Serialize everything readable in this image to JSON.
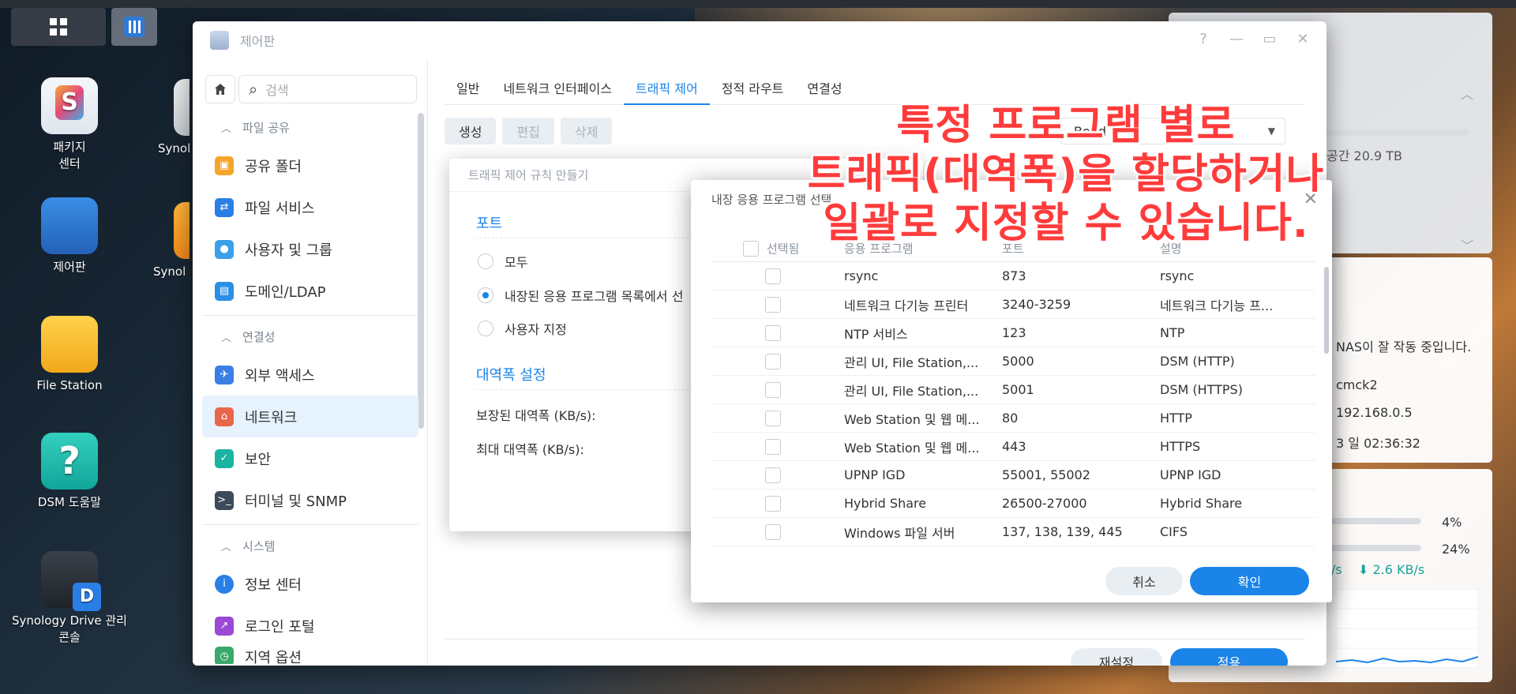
{
  "desktop": {
    "icons": [
      {
        "label": "패키지\n센터"
      },
      {
        "label": "제어판"
      },
      {
        "label": "File Station"
      },
      {
        "label": "DSM 도움말"
      },
      {
        "label": "Synology Drive 관리\n콘솔"
      },
      {
        "label": "Synol"
      },
      {
        "label": "Synol"
      }
    ]
  },
  "window": {
    "title": "제어판",
    "controls": {
      "help": "?",
      "minimize": "—",
      "maximize": "▭",
      "close": "✕"
    }
  },
  "sidebar": {
    "search_placeholder": "검색",
    "groups": [
      {
        "label": "파일 공유",
        "items": [
          "공유 폴더",
          "파일 서비스",
          "사용자 및 그룹",
          "도메인/LDAP"
        ]
      },
      {
        "label": "연결성",
        "items": [
          "외부 액세스",
          "네트워크",
          "보안",
          "터미널 및 SNMP"
        ]
      },
      {
        "label": "시스템",
        "items": [
          "정보 센터",
          "로그인 포털",
          "지역 옵션"
        ]
      }
    ],
    "active_item": "네트워크"
  },
  "tabs": [
    "일반",
    "네트워크 인터페이스",
    "트래픽 제어",
    "정적 라우트",
    "연결성"
  ],
  "active_tab": "트래픽 제어",
  "toolbar": {
    "create": "생성",
    "edit": "편집",
    "delete": "삭제"
  },
  "filter_value": "Bond",
  "footer": {
    "reset": "재설정",
    "apply": "적용"
  },
  "rule_dialog": {
    "title": "트래픽 제어 규칙 만들기",
    "port_section": "포트",
    "options": [
      "모두",
      "내장된 응용 프로그램 목록에서 선",
      "사용자 지정"
    ],
    "selected_option": 1,
    "bandwidth_section": "대역폭 설정",
    "guaranteed_label": "보장된 대역폭 (KB/s):",
    "max_label": "최대 대역폭 (KB/s):"
  },
  "app_dialog": {
    "title": "내장 응용 프로그램 선택",
    "close": "✕",
    "columns": [
      "선택됨",
      "응용 프로그램",
      "포트",
      "설명"
    ],
    "rows": [
      {
        "app": "rsync",
        "port": "873",
        "desc": "rsync"
      },
      {
        "app": "네트워크 다기능 프린터",
        "port": "3240-3259",
        "desc": "네트워크 다기능 프..."
      },
      {
        "app": "NTP 서비스",
        "port": "123",
        "desc": "NTP"
      },
      {
        "app": "관리 UI, File Station,...",
        "port": "5000",
        "desc": "DSM (HTTP)"
      },
      {
        "app": "관리 UI, File Station,...",
        "port": "5001",
        "desc": "DSM (HTTPS)"
      },
      {
        "app": "Web Station 및 웹 메...",
        "port": "80",
        "desc": "HTTP"
      },
      {
        "app": "Web Station 및 웹 메...",
        "port": "443",
        "desc": "HTTPS"
      },
      {
        "app": "UPNP IGD",
        "port": "55001, 55002",
        "desc": "UPNP IGD"
      },
      {
        "app": "Hybrid Share",
        "port": "26500-27000",
        "desc": "Hybrid Share"
      },
      {
        "app": "Windows 파일 서버",
        "port": "137, 138, 139, 445",
        "desc": "CIFS"
      }
    ],
    "cancel": "취소",
    "ok": "확인"
  },
  "widgets": {
    "storage_text": "공간 20.9 TB",
    "health_text": "NAS이 잘 작동 중입니다.",
    "server_name": "cmck2",
    "ip": "192.168.0.5",
    "uptime": "3 일 02:36:32",
    "cpu": "4%",
    "ram": "24%",
    "net_up": "/s",
    "net_down": "⬇ 2.6 KB/s"
  },
  "annotation": [
    "특정 프로그램 별로",
    "트래픽(대역폭)을 할당하거나",
    "일괄로 지정할 수 있습니다."
  ]
}
